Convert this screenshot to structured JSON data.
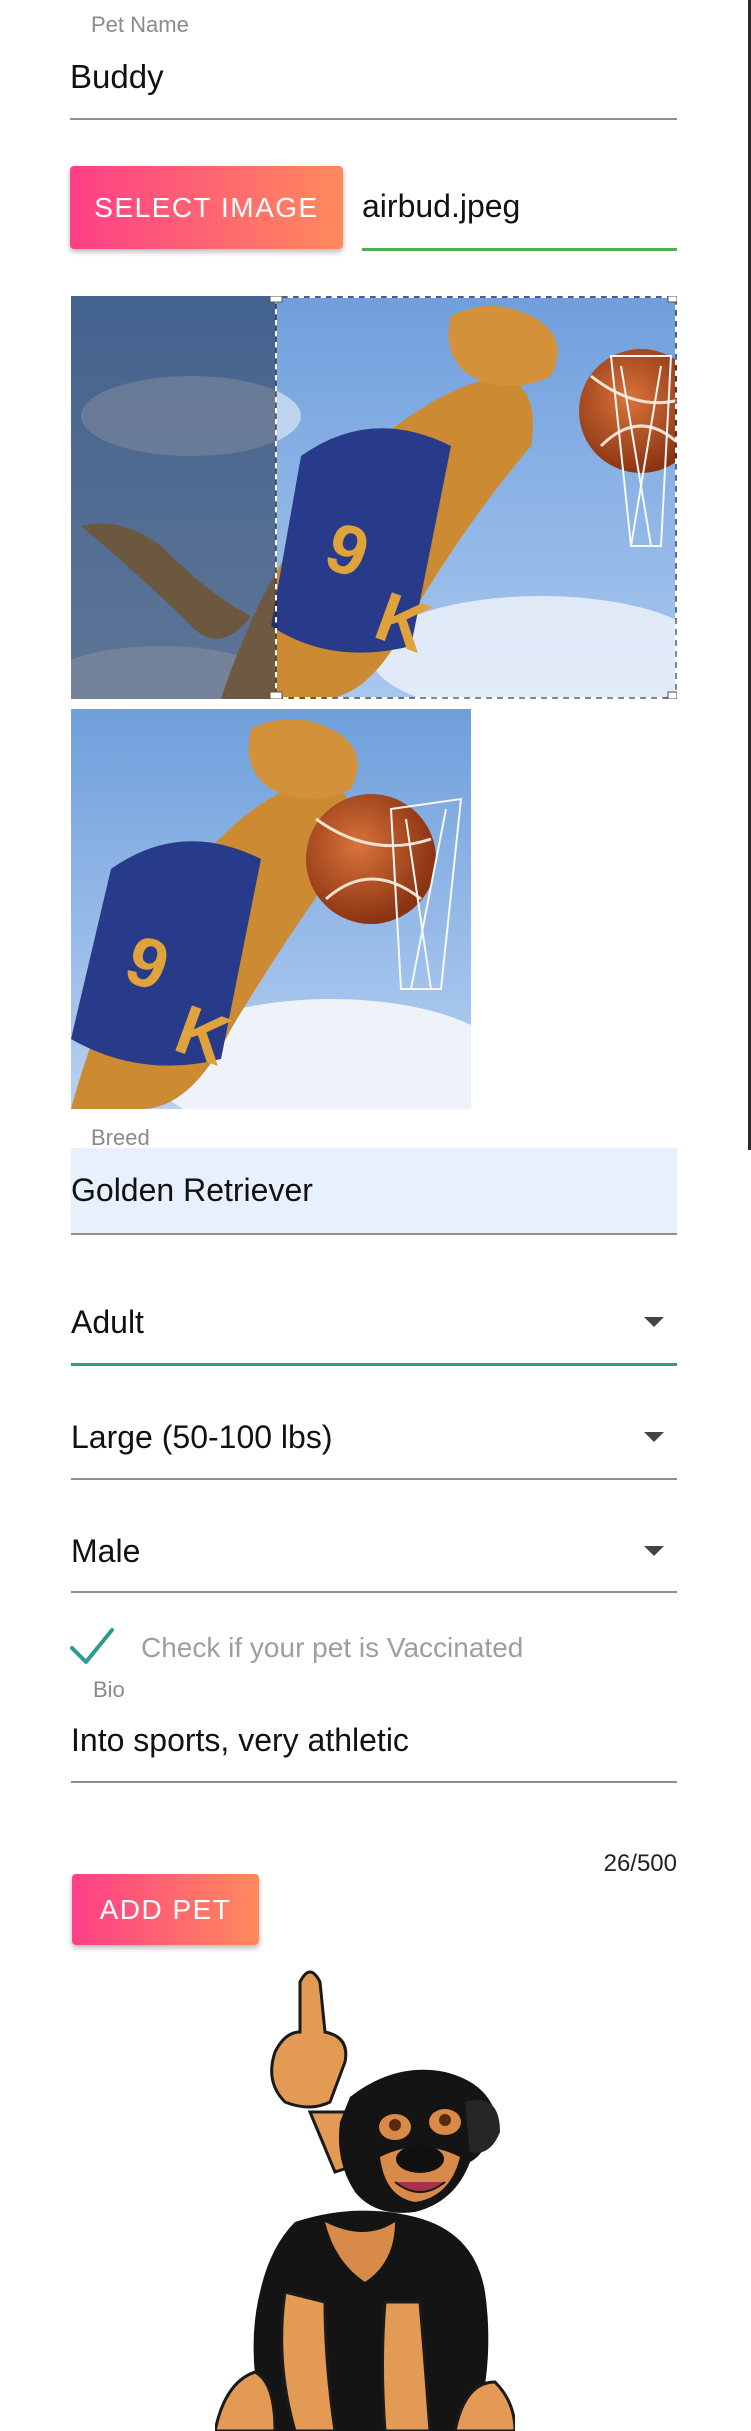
{
  "pet_name": {
    "label": "Pet Name",
    "value": "Buddy"
  },
  "image": {
    "button_label": "SELECT IMAGE",
    "filename": "airbud.jpeg"
  },
  "breed": {
    "label": "Breed",
    "value": "Golden Retriever"
  },
  "age": {
    "value": "Adult",
    "icon": "dropdown-caret-icon"
  },
  "size": {
    "value": "Large (50-100 lbs)",
    "icon": "dropdown-caret-icon"
  },
  "gender": {
    "value": "Male",
    "icon": "dropdown-caret-icon"
  },
  "vaccinated": {
    "label": "Check if your pet is Vaccinated",
    "checked": true
  },
  "bio": {
    "label": "Bio",
    "value": "Into sports, very athletic",
    "counter": "26/500"
  },
  "submit": {
    "label": "ADD PET"
  },
  "colors": {
    "accent_gradient_start": "#fe3f87",
    "accent_gradient_end": "#ff8a5c",
    "active_underline_green": "#4caf50",
    "active_underline_teal": "#2e9c7f",
    "check_color": "#2e9c8f",
    "breed_fill": "#e8f0fe"
  }
}
